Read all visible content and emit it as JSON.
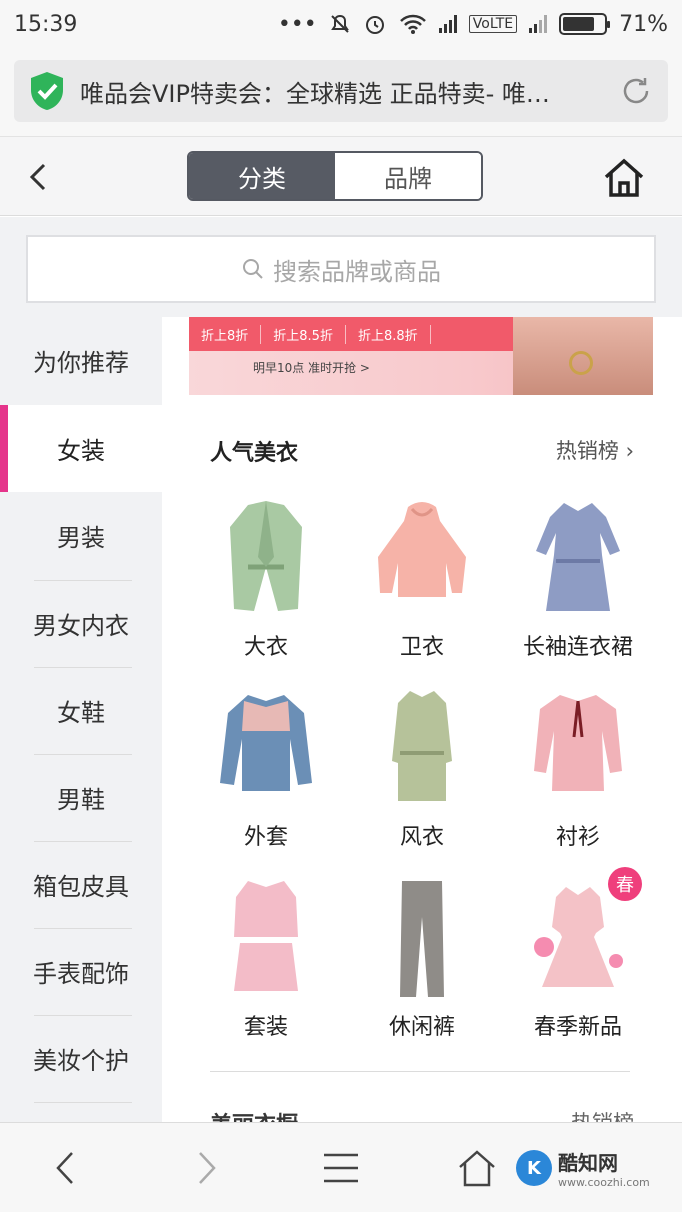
{
  "status": {
    "time": "15:39",
    "dots": "•••",
    "network": "VoLTE",
    "battery": "71%"
  },
  "browser": {
    "page_title": "唯品会VIP特卖会：全球精选 正品特卖- 唯…"
  },
  "nav": {
    "tabs": [
      {
        "label": "分类",
        "active": true
      },
      {
        "label": "品牌",
        "active": false
      }
    ]
  },
  "search": {
    "placeholder": "搜索品牌或商品"
  },
  "sidebar": {
    "items": [
      "为你推荐",
      "女装",
      "男装",
      "男女内衣",
      "女鞋",
      "男鞋",
      "箱包皮具",
      "手表配饰",
      "美妆个护"
    ],
    "selected": "女装"
  },
  "banner": {
    "discounts": [
      "折上8折",
      "折上8.5折",
      "折上8.8折"
    ],
    "note": "明早10点 准时开抢 >"
  },
  "section": {
    "title": "人气美衣",
    "link": "热销榜 ›"
  },
  "categories": [
    {
      "label": "大衣",
      "icon": "coat-icon"
    },
    {
      "label": "卫衣",
      "icon": "hoodie-icon"
    },
    {
      "label": "长袖连衣裙",
      "icon": "dress-icon"
    },
    {
      "label": "外套",
      "icon": "jacket-icon"
    },
    {
      "label": "风衣",
      "icon": "trench-coat-icon"
    },
    {
      "label": "衬衫",
      "icon": "shirt-icon"
    },
    {
      "label": "套装",
      "icon": "suit-icon"
    },
    {
      "label": "休闲裤",
      "icon": "pants-icon"
    },
    {
      "label": "春季新品",
      "icon": "spring-dress-icon",
      "badge": "春"
    }
  ],
  "next_section": {
    "title": "美丽衣橱",
    "link": "热销榜"
  },
  "watermark": {
    "logo": "K",
    "name": "酷知网",
    "url": "www.coozhi.com"
  },
  "colors": {
    "accent": "#e5358b",
    "tab_active": "#575b64"
  }
}
